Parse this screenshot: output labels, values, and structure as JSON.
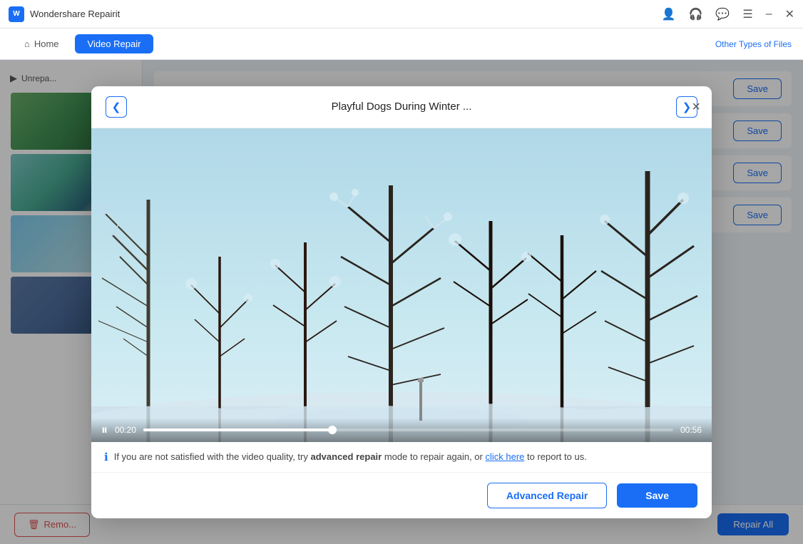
{
  "app": {
    "title": "Wondershare Repairit",
    "logo_label": "W"
  },
  "titlebar": {
    "controls": [
      "person-icon",
      "headphone-icon",
      "chat-icon",
      "menu-icon",
      "minimize-icon",
      "close-icon"
    ]
  },
  "navbar": {
    "tabs": [
      {
        "id": "home",
        "label": "Home",
        "active": false
      },
      {
        "id": "video-repair",
        "label": "Video Repair",
        "active": true
      }
    ],
    "right_link": "Other Types of Files"
  },
  "left_panel": {
    "section_label": "Unrepa..."
  },
  "file_rows": [
    {
      "id": 1,
      "save_label": "Save"
    },
    {
      "id": 2,
      "save_label": "Save"
    },
    {
      "id": 3,
      "save_label": "Save"
    },
    {
      "id": 4,
      "save_label": "Save"
    }
  ],
  "bottom_bar": {
    "remove_label": "Remo...",
    "repair_all_label": "Repair All"
  },
  "modal": {
    "prev_label": "<",
    "next_label": ">",
    "title": "Playful Dogs During Winter ...",
    "close_label": "×",
    "video": {
      "current_time": "00:20",
      "total_time": "00:56",
      "progress_percent": 35.7
    },
    "info_text_before": "If you are not satisfied with the video quality, try ",
    "info_bold": "advanced repair",
    "info_text_middle": " mode to repair again, or ",
    "info_link": "click here",
    "info_text_after": " to report to us.",
    "advanced_repair_label": "Advanced Repair",
    "save_label": "Save"
  },
  "colors": {
    "accent": "#1a6ef5",
    "danger": "#e05252",
    "bg": "#f0f4f8"
  }
}
